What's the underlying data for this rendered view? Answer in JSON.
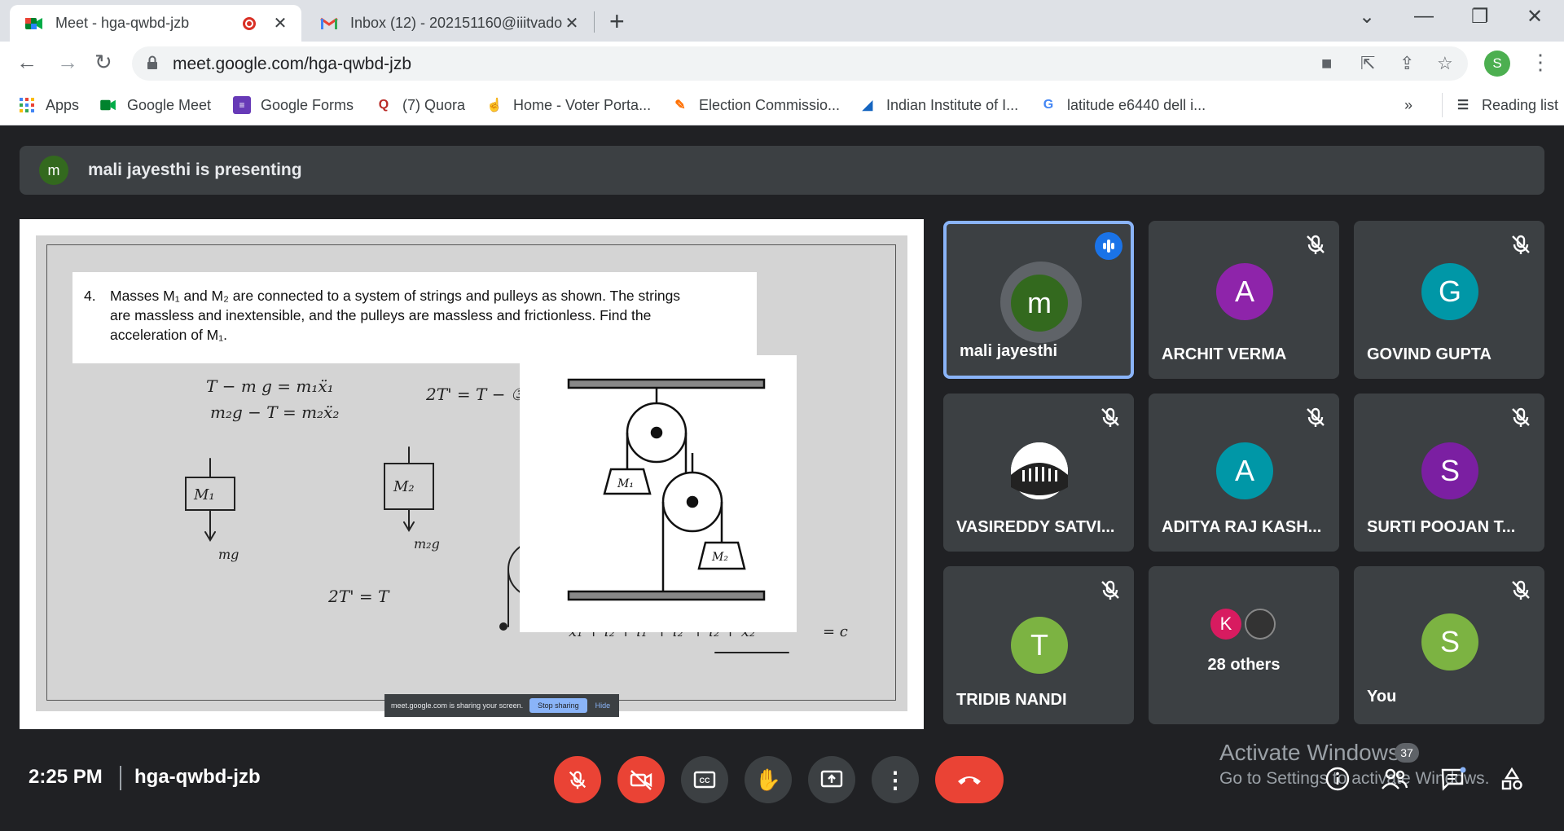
{
  "browser": {
    "tabs": [
      {
        "title": "Meet - hga-qwbd-jzb"
      },
      {
        "title": "Inbox (12) - 202151160@iiitvado"
      }
    ],
    "url": "meet.google.com/hga-qwbd-jzb",
    "profile_initial": "S",
    "bookmarks": [
      {
        "label": "Apps"
      },
      {
        "label": "Google Meet"
      },
      {
        "label": "Google Forms"
      },
      {
        "label": "(7) Quora"
      },
      {
        "label": "Home - Voter Porta..."
      },
      {
        "label": "Election Commissio..."
      },
      {
        "label": "Indian Institute of I..."
      },
      {
        "label": "latitude e6440 dell i..."
      }
    ],
    "overflow": "»",
    "reading_list": "Reading list"
  },
  "meet": {
    "presenter_initial": "m",
    "presenting_text": "mali jayesthi is presenting",
    "question": {
      "number": "4.",
      "text": "Masses M₁ and M₂ are connected to a system of strings and pulleys as shown. The strings are massless and inextensible, and the pulleys are massless and frictionless. Find the acceleration of M₁."
    },
    "share_bar": {
      "text": "meet.google.com is sharing your screen.",
      "stop": "Stop sharing",
      "hide": "Hide"
    },
    "participants": [
      {
        "initial": "m",
        "name": "mali jayesthi",
        "color": "#33691e",
        "speaking": true
      },
      {
        "initial": "A",
        "name": "ARCHIT VERMA",
        "color": "#8e24aa"
      },
      {
        "initial": "G",
        "name": "GOVIND GUPTA",
        "color": "#0097a7"
      },
      {
        "initial": "",
        "name": "VASIREDDY SATVI...",
        "color": "#ffffff"
      },
      {
        "initial": "A",
        "name": "ADITYA RAJ KASH...",
        "color": "#0097a7"
      },
      {
        "initial": "S",
        "name": "SURTI POOJAN T...",
        "color": "#7b1fa2"
      },
      {
        "initial": "T",
        "name": "TRIDIB NANDI",
        "color": "#7cb342"
      },
      {
        "initial": "K",
        "name": "28 others",
        "color": "#d81b60"
      },
      {
        "initial": "S",
        "name": "You",
        "color": "#7cb342"
      }
    ],
    "time": "2:25 PM",
    "meeting_code": "hga-qwbd-jzb",
    "activate_title": "Activate Windows",
    "activate_sub": "Go to Settings to activate Windows.",
    "participant_count": "37"
  }
}
